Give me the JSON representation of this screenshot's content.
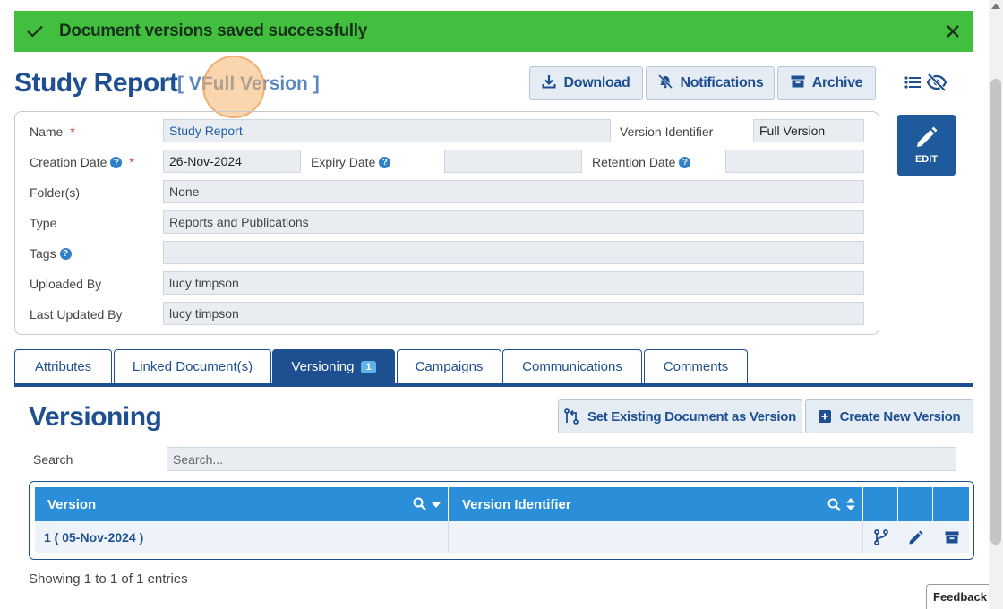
{
  "banner": {
    "message": "Document versions saved successfully"
  },
  "header": {
    "title": "Study Report",
    "subtitle": "[ VFull Version ]",
    "buttons": {
      "download": "Download",
      "notifications": "Notifications",
      "archive": "Archive"
    }
  },
  "details": {
    "name": {
      "label": "Name",
      "value": "Study Report"
    },
    "version_identifier": {
      "label": "Version Identifier",
      "value": "Full Version"
    },
    "creation_date": {
      "label": "Creation Date",
      "value": "26-Nov-2024"
    },
    "expiry_date": {
      "label": "Expiry Date",
      "value": ""
    },
    "retention_date": {
      "label": "Retention Date",
      "value": ""
    },
    "folders": {
      "label": "Folder(s)",
      "value": "None"
    },
    "type": {
      "label": "Type",
      "value": "Reports and Publications"
    },
    "tags": {
      "label": "Tags",
      "value": ""
    },
    "uploaded_by": {
      "label": "Uploaded By",
      "value": "lucy timpson"
    },
    "last_updated_by": {
      "label": "Last Updated By",
      "value": "lucy timpson"
    },
    "required_mark": "*",
    "help_mark": "?"
  },
  "edit_button": {
    "label": "EDIT"
  },
  "tabs": [
    {
      "label": "Attributes"
    },
    {
      "label": "Linked Document(s)"
    },
    {
      "label": "Versioning",
      "badge": "1"
    },
    {
      "label": "Campaigns"
    },
    {
      "label": "Communications"
    },
    {
      "label": "Comments"
    }
  ],
  "versioning": {
    "title": "Versioning",
    "set_existing_label": "Set Existing Document as Version",
    "create_new_label": "Create New Version",
    "search_label": "Search",
    "search_placeholder": "Search...",
    "columns": {
      "version": "Version",
      "version_identifier": "Version Identifier"
    },
    "rows": [
      {
        "version": "1 ( 05-Nov-2024 )",
        "version_identifier": ""
      }
    ],
    "showing": "Showing 1 to 1 of 1 entries"
  },
  "feedback": {
    "label": "Feedback"
  },
  "colors": {
    "banner": "#43bf40",
    "primary": "#1d4f91",
    "table_header": "#2a8fd8"
  }
}
